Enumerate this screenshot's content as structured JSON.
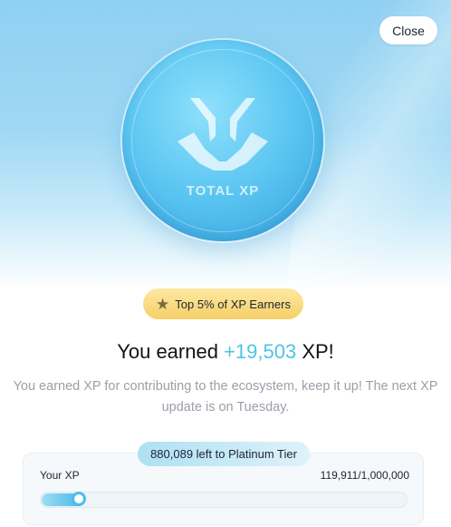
{
  "close_label": "Close",
  "coin": {
    "label": "TOTAL XP",
    "icon": "xp-logo-icon"
  },
  "badge": {
    "icon": "star-icon",
    "text": "Top 5% of XP Earners"
  },
  "title": {
    "prefix": "You earned ",
    "amount": "+19,503",
    "suffix": " XP!"
  },
  "subtitle": "You earned XP for contributing to the ecosystem, keep it up! The next XP update is on Tuesday.",
  "progress": {
    "tier_text": "880,089 left to Platinum Tier",
    "label": "Your XP",
    "count_text": "119,911/1,000,000",
    "current": 119911,
    "max": 1000000
  },
  "colors": {
    "accent": "#4cc4ea",
    "hero_blue": "#8fd0f1",
    "badge_gold": "#f6cf68",
    "text_dark": "#111318",
    "text_muted": "#9aa0a8"
  }
}
